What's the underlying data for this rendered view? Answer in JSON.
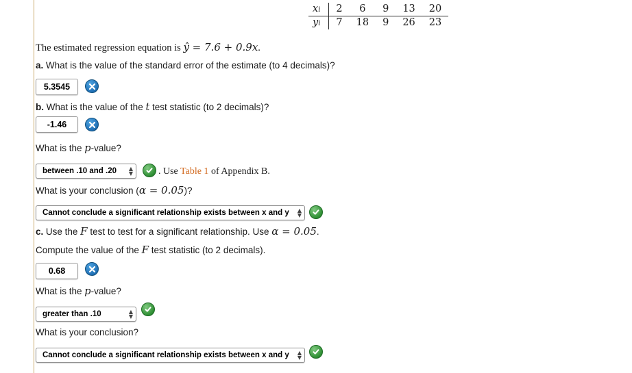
{
  "data_table": {
    "row_labels": [
      "xi",
      "yi"
    ],
    "x_values": [
      "2",
      "6",
      "9",
      "13",
      "20"
    ],
    "y_values": [
      "7",
      "18",
      "9",
      "26",
      "23"
    ]
  },
  "intro": {
    "text_before": "The estimated regression equation is ",
    "equation": "ŷ = 7.6 + 0.9x",
    "text_after": "."
  },
  "parts": {
    "a": {
      "letter": "a.",
      "question": "What is the value of the standard error of the estimate (to 4 decimals)?",
      "answer": "5.3545",
      "status": "incorrect"
    },
    "b": {
      "letter": "b.",
      "question_1": "What is the value of the ",
      "question_1_it": "t",
      "question_1_rest": " test statistic (to 2 decimals)?",
      "answer": "-1.46",
      "status": "incorrect",
      "pvalue_question_pre": "What is the ",
      "pvalue_question_it": "p",
      "pvalue_question_post": "-value?",
      "pvalue_answer": "between .10 and .20",
      "pvalue_status": "correct",
      "pvalue_suffix_pre": ". Use ",
      "pvalue_suffix_link": "Table 1",
      "pvalue_suffix_post": " of Appendix B.",
      "conclusion_question_pre": "What is your conclusion (",
      "conclusion_question_math": "α = 0.05",
      "conclusion_question_post": ")?",
      "conclusion_answer": "Cannot conclude a significant relationship exists between x and y",
      "conclusion_status": "correct"
    },
    "c": {
      "letter": "c.",
      "question_pre": "Use the ",
      "question_F": "F",
      "question_mid": " test to test for a significant relationship. Use ",
      "question_alpha": "α = 0.05",
      "question_post": ".",
      "compute_pre": "Compute the value of the ",
      "compute_F": "F",
      "compute_post": " test statistic (to 2 decimals).",
      "answer": "0.68",
      "status": "incorrect",
      "pvalue_question_pre": "What is the ",
      "pvalue_question_it": "p",
      "pvalue_question_post": "-value?",
      "pvalue_answer": "greater than .10",
      "pvalue_status": "correct",
      "conclusion_question": "What is your conclusion?",
      "conclusion_answer": "Cannot conclude a significant relationship exists between x and y",
      "conclusion_status": "correct"
    }
  },
  "colors": {
    "rule": "#c8a96a",
    "link": "#d2691e",
    "correct": "#2f8f34",
    "incorrect": "#1f6fb5"
  }
}
